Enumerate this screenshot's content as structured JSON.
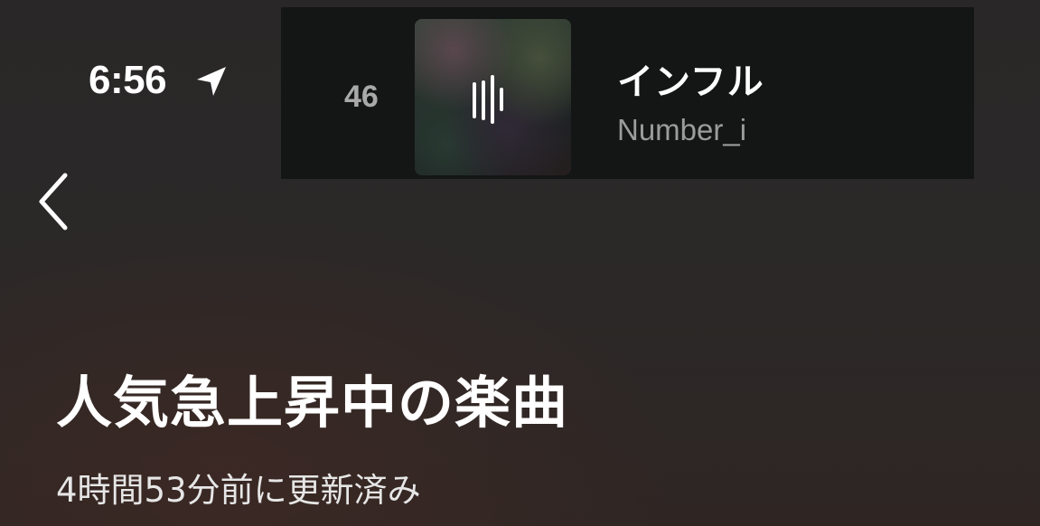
{
  "status_bar": {
    "time": "6:56",
    "location_icon": "location-arrow-icon"
  },
  "now_playing": {
    "rank": "46",
    "title": "インフル",
    "artist": "Number_i",
    "artwork_icon": "now-playing-bars-icon"
  },
  "nav": {
    "back_icon": "chevron-left-icon"
  },
  "header": {
    "title": "人気急上昇中の楽曲",
    "updated": "4時間53分前に更新済み"
  },
  "colors": {
    "background": "#2a2626",
    "banner": "#141616",
    "rank_text": "#a9a9a9",
    "artist_text": "#9c9c9c"
  }
}
